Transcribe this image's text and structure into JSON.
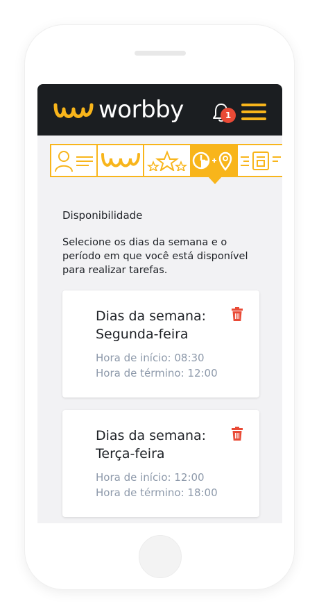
{
  "header": {
    "brand": "worbby",
    "notification_count": "1"
  },
  "steps": [
    {
      "icon": "profile-icon",
      "active": false
    },
    {
      "icon": "worbby-mark-icon",
      "active": false
    },
    {
      "icon": "stars-icon",
      "active": false
    },
    {
      "icon": "clock-location-icon",
      "active": true
    },
    {
      "icon": "document-icon",
      "active": false
    }
  ],
  "main": {
    "title": "Disponibilidade",
    "description": "Selecione os dias da semana e o período em que você está disponível para realizar tarefas."
  },
  "availability": [
    {
      "days": "Dias da semana: Segunda-feira",
      "start": "Hora de início: 08:30",
      "end": "Hora de término: 12:00"
    },
    {
      "days": "Dias da semana: Terça-feira",
      "start": "Hora de início: 12:00",
      "end": "Hora de término: 18:00"
    }
  ],
  "colors": {
    "brand": "#f8b51b",
    "dark": "#1b1e21",
    "danger": "#e94a36",
    "muted": "#8d99aa"
  }
}
